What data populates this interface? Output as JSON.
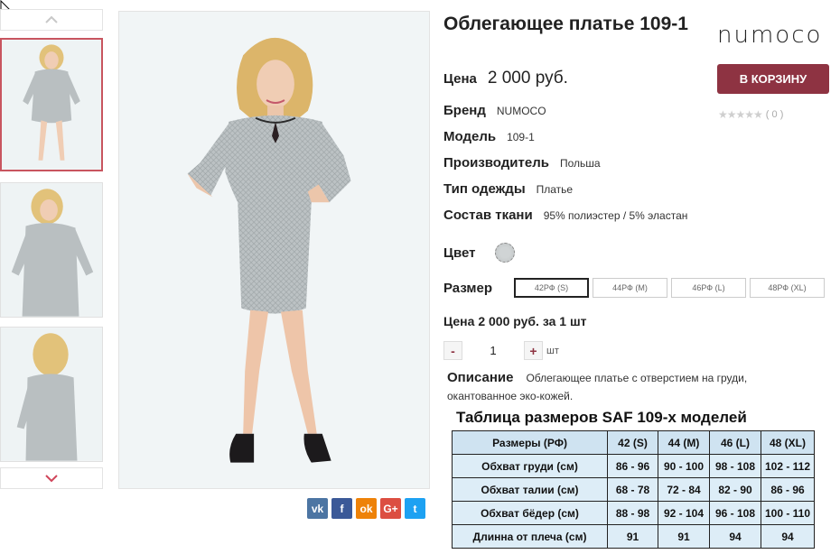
{
  "product": {
    "title": "Облегающее платье 109-1",
    "brand_logo": "NUMOCO",
    "price_label": "Цена",
    "price_value": "2 000 руб.",
    "cart_button": "В КОРЗИНУ",
    "rating_count": "( 0 )",
    "rating_value": 0,
    "rating_max": 5
  },
  "specs": [
    {
      "label": "Бренд",
      "value": "NUMOCO"
    },
    {
      "label": "Модель",
      "value": "109-1"
    },
    {
      "label": "Производитель",
      "value": "Польша"
    },
    {
      "label": "Тип одежды",
      "value": "Платье"
    },
    {
      "label": "Состав ткани",
      "value": "95% полиэстер / 5% эластан"
    }
  ],
  "color": {
    "label": "Цвет",
    "swatch": "#c9cdce"
  },
  "size": {
    "label": "Размер",
    "options": [
      "42РФ (S)",
      "44РФ (M)",
      "46РФ (L)",
      "48РФ (XL)"
    ],
    "selected": "42РФ (S)"
  },
  "unit_price": "Цена 2 000 руб. за 1 шт",
  "quantity": {
    "minus": "-",
    "value": "1",
    "plus": "+",
    "unit": "шт"
  },
  "description": {
    "label": "Описание",
    "text": "Облегающее платье с отверстием на груди, окантованное эко-кожей."
  },
  "size_table": {
    "title": "Таблица размеров SAF 109-х моделей",
    "header": [
      "Размеры (РФ)",
      "42 (S)",
      "44 (M)",
      "46 (L)",
      "48 (XL)"
    ],
    "rows": [
      [
        "Обхват груди (см)",
        "86 - 96",
        "90 - 100",
        "98 - 108",
        "102 - 112"
      ],
      [
        "Обхват талии (см)",
        "68 - 78",
        "72 - 84",
        "82 - 90",
        "86 - 96"
      ],
      [
        "Обхват бёдер (см)",
        "88 - 98",
        "92 - 104",
        "96 - 108",
        "100 - 110"
      ],
      [
        "Длинна от плеча (см)",
        "91",
        "91",
        "94",
        "94"
      ]
    ]
  },
  "share": [
    {
      "icon": "vk-icon",
      "glyph": "vk",
      "color": "#4c75a3"
    },
    {
      "icon": "facebook-icon",
      "glyph": "f",
      "color": "#3b5998"
    },
    {
      "icon": "odnoklassniki-icon",
      "glyph": "ok",
      "color": "#ee8208"
    },
    {
      "icon": "google-plus-icon",
      "glyph": "G+",
      "color": "#dc4e41"
    },
    {
      "icon": "twitter-icon",
      "glyph": "t",
      "color": "#1da1f2"
    }
  ],
  "colors": {
    "accent": "#8e3342",
    "thumb_active_border": "#c8555f",
    "table_bg": "#ddedf7"
  }
}
